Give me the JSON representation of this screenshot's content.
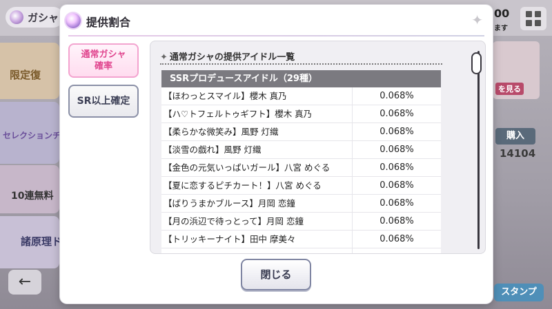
{
  "background": {
    "title": "ガシャ",
    "banners": [
      "限定復",
      "セレクションチ",
      "10連無料",
      "諸原理ド"
    ],
    "right_card_label": "を見る",
    "buy_label": "購入",
    "count_value": "14104",
    "top_partial": "00",
    "top_partial2": "ます",
    "stamp_label": "スタンプ",
    "back_icon": "arrow-left-icon"
  },
  "modal": {
    "title": "提供割合",
    "tabs": [
      {
        "label_line1": "通常ガシャ",
        "label_line2": "確率",
        "active": true
      },
      {
        "label": "SR以上確定",
        "active": false
      }
    ],
    "panel_heading": "通常ガシャの提供アイドル一覧",
    "table_header": "SSRプロデュースアイドル（29種）",
    "rows": [
      {
        "name": "【ほわっとスマイル】櫻木 真乃",
        "rate": "0.068%"
      },
      {
        "name": "【ハ♡トフェルトゥギフト】櫻木 真乃",
        "rate": "0.068%"
      },
      {
        "name": "【柔らかな微笑み】風野 灯織",
        "rate": "0.068%"
      },
      {
        "name": "【淡雪の戯れ】風野 灯織",
        "rate": "0.068%"
      },
      {
        "name": "【金色の元気いっぱいガール】八宮 めぐる",
        "rate": "0.068%"
      },
      {
        "name": "【夏に恋するピチカート！】八宮 めぐる",
        "rate": "0.068%"
      },
      {
        "name": "【ばりうまかブルース】月岡 恋鐘",
        "rate": "0.068%"
      },
      {
        "name": "【月の浜辺で待っとって】月岡 恋鐘",
        "rate": "0.068%"
      },
      {
        "name": "【トリッキーナイト】田中 摩美々",
        "rate": "0.068%"
      }
    ],
    "close_label": "閉じる"
  }
}
